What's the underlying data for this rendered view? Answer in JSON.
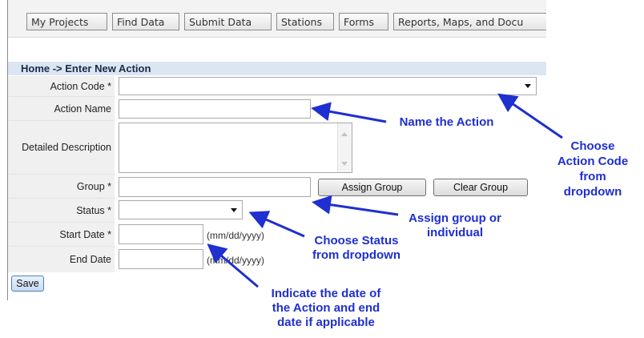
{
  "nav": {
    "tabs": [
      {
        "label": "My Projects"
      },
      {
        "label": "Find Data"
      },
      {
        "label": "Submit Data"
      },
      {
        "label": "Stations"
      },
      {
        "label": "Forms"
      },
      {
        "label": "Reports, Maps, and Docu"
      }
    ]
  },
  "breadcrumb": "Home -> Enter New Action",
  "form": {
    "action_code_label": "Action Code *",
    "action_name_label": "Action Name",
    "description_label": "Detailed Description",
    "group_label": "Group *",
    "status_label": "Status *",
    "start_date_label": "Start Date *",
    "end_date_label": "End Date",
    "start_date_hint": "(mm/dd/yyyy)",
    "end_date_hint": "(mm/dd/yyyy)",
    "assign_group_button": "Assign Group",
    "clear_group_button": "Clear Group",
    "save_button": "Save"
  },
  "annotations": {
    "name_action": "Name the Action",
    "choose_code": [
      "Choose",
      "Action Code",
      "from",
      "dropdown"
    ],
    "assign_group": [
      "Assign group or",
      "individual"
    ],
    "choose_status": [
      "Choose Status",
      "from dropdown"
    ],
    "indicate_date": [
      "Indicate the date of",
      "the Action and end",
      "date if applicable"
    ]
  },
  "colors": {
    "annotation_text": "#1f2fd0",
    "arrow": "#1f2fd0"
  }
}
